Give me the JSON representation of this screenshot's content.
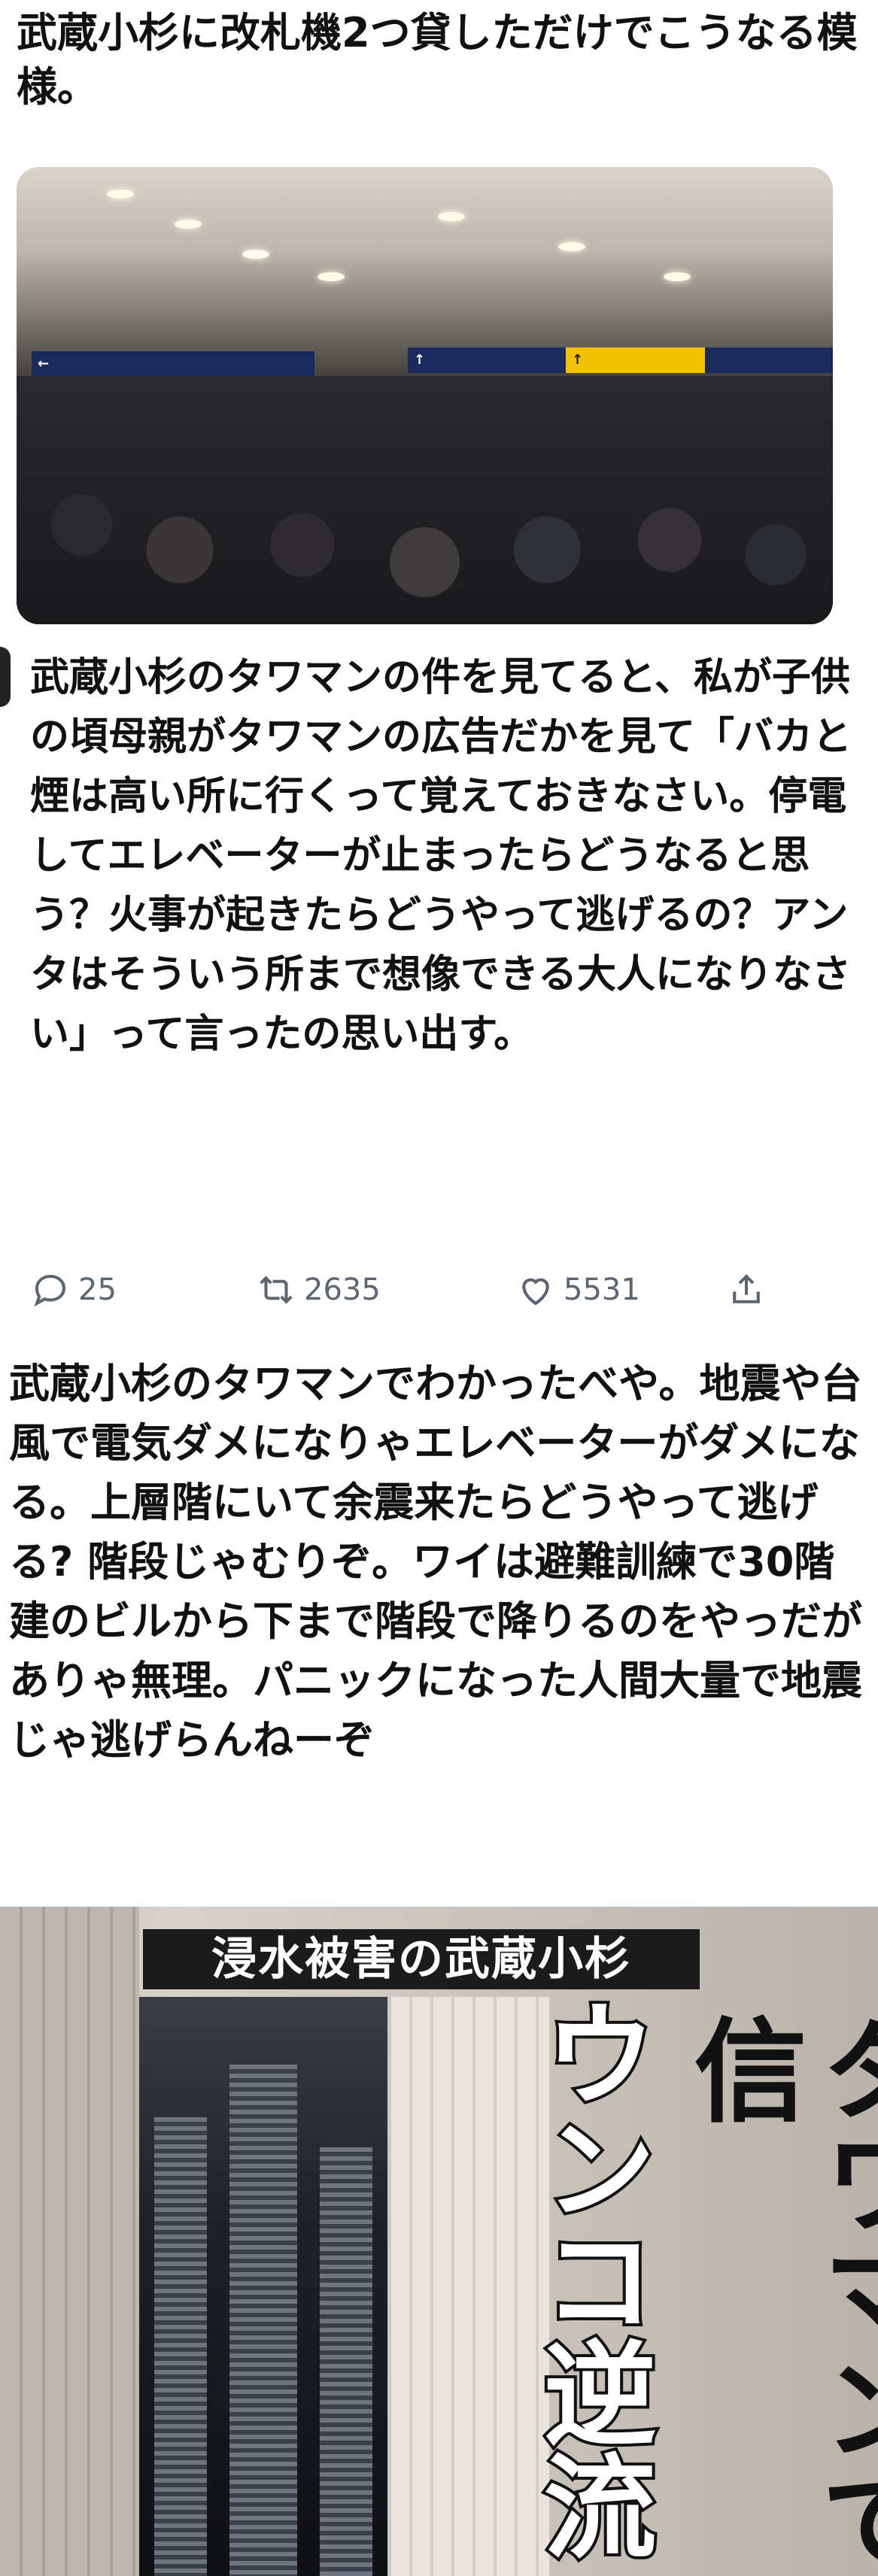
{
  "post1": {
    "text": "武蔵小杉に改札機2つ貸しただけでこうなる模様。",
    "photo": {
      "description_signs": [
        "←",
        "↑",
        "↑"
      ],
      "signs_colors": {
        "dark": "#1a2a5a",
        "yellow": "#f2c200"
      }
    }
  },
  "post2": {
    "text": "武蔵小杉のタワマンの件を見てると、私が子供の頃母親がタワマンの広告だかを見て「バカと煙は高い所に行くって覚えておきなさい。停電してエレベーターが止まったらどうなると思う？火事が起きたらどうやって逃げるの？アンタはそういう所まで想像できる大人になりなさい」って言ったの思い出す。",
    "actions": {
      "reply_count": "25",
      "retweet_count": "2635",
      "like_count": "5531",
      "reply_icon": "reply-icon",
      "retweet_icon": "retweet-icon",
      "like_icon": "heart-icon",
      "share_icon": "share-icon"
    }
  },
  "post3": {
    "text": "武蔵小杉のタワマンでわかったべや。地震や台風で電気ダメになりゃエレベーターがダメになる。上層階にいて余震来たらどうやって逃げる? 階段じゃむりぞ。ワイは避難訓練で30階建のビルから下まで階段で降りるのをやっだがありゃ無理。パニックになった人間大量で地震じゃ逃げらんねーぞ"
  },
  "magazine": {
    "headline": "浸水被害の武蔵小杉",
    "big_text_1": "タワマンで信",
    "big_text_2": "ウンコ逆流"
  }
}
